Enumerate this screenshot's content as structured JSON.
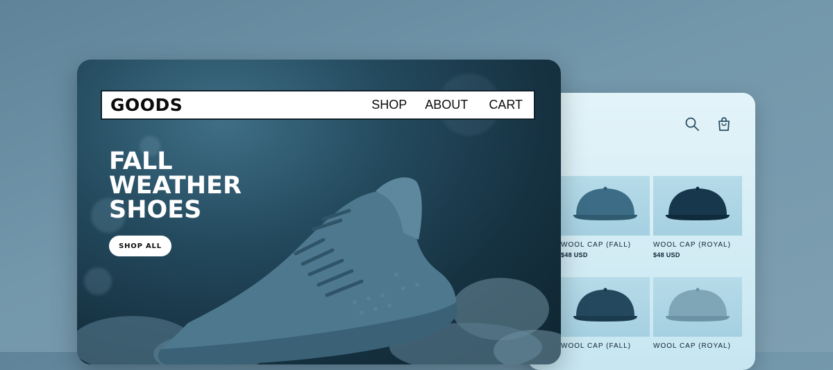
{
  "hero": {
    "logo": "GOODS",
    "nav": [
      {
        "label": "SHOP"
      },
      {
        "label": "ABOUT"
      },
      {
        "label": "CART"
      }
    ],
    "headline": [
      "FALL",
      "WEATHER",
      "SHOES"
    ],
    "cta_label": "SHOP ALL"
  },
  "catalog": {
    "icons": [
      "search-icon",
      "shopping-bag-icon"
    ],
    "products": [
      {
        "name": "WOOL CAP (FALL)",
        "price": "$48 USD",
        "color": "#3d6d86"
      },
      {
        "name": "WOOL CAP (ROYAL)",
        "price": "$48 USD",
        "color": "#17384c"
      },
      {
        "name": "WOOL CAP (FALL)",
        "price": "",
        "color": "#24485e"
      },
      {
        "name": "WOOL CAP (ROYAL)",
        "price": "",
        "color": "#7fa6b7"
      }
    ]
  },
  "colors": {
    "background": "#6e93a8",
    "hero_dark": "#15303f",
    "catalog_bg": "#d5edf5"
  }
}
